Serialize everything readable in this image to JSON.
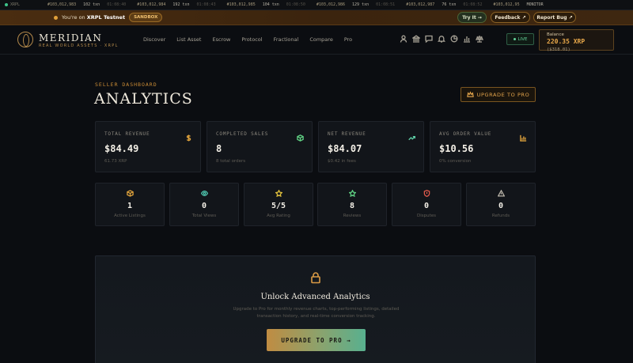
{
  "ticker": {
    "label": "XRPL",
    "items": [
      {
        "block": "#103,012,983",
        "txn": "102 txn",
        "time": "01:08:40"
      },
      {
        "block": "#103,012,984",
        "txn": "192 txn",
        "time": "01:08:43"
      },
      {
        "block": "#103,012,985",
        "txn": "104 txn",
        "time": "01:08:50"
      },
      {
        "block": "#103,012,986",
        "txn": "129 txn",
        "time": "01:08:51"
      },
      {
        "block": "#103,012,987",
        "txn": "76 txn",
        "time": "01:08:52"
      },
      {
        "block": "#103,012,95",
        "txn": "MONITOR",
        "time": ""
      }
    ]
  },
  "banner": {
    "prefix": "You're on",
    "network": "XRPL Testnet",
    "badge": "SANDBOX",
    "try_label": "Try It →",
    "feedback_label": "Feedback ↗",
    "report_label": "Report Bug ↗"
  },
  "header": {
    "brand": "MERIDIAN",
    "tagline": "REAL WORLD ASSETS · XRPL",
    "nav": [
      "Discover",
      "List Asset",
      "Escrow",
      "Protocol",
      "Fractional",
      "Compare",
      "Pro"
    ],
    "icons": [
      "user-icon",
      "bank-icon",
      "chat-icon",
      "bell-icon",
      "pie-chart-icon",
      "bar-chart-icon",
      "scale-icon"
    ],
    "live_label": "LIVE",
    "balance_label": "Balance",
    "balance_value": "220.35 XRP",
    "balance_fiat": "($318.01)"
  },
  "page": {
    "kicker": "SELLER DASHBOARD",
    "title": "ANALYTICS",
    "upgrade_label": "UPGRADE TO PRO"
  },
  "stats": [
    {
      "label": "TOTAL REVENUE",
      "value": "$84.49",
      "sub": "61.73 XRP",
      "icon": "dollar-icon",
      "color": "#e0a33c"
    },
    {
      "label": "COMPLETED SALES",
      "value": "8",
      "sub": "8 total orders",
      "icon": "box-icon",
      "color": "#5fcf82"
    },
    {
      "label": "NET REVENUE",
      "value": "$84.07",
      "sub": "$0.42 in fees",
      "icon": "trend-up-icon",
      "color": "#5fcfa7"
    },
    {
      "label": "AVG ORDER VALUE",
      "value": "$10.56",
      "sub": "0% conversion",
      "icon": "bar-chart-icon",
      "color": "#e0a33c"
    }
  ],
  "minis": [
    {
      "value": "1",
      "label": "Active Listings",
      "icon": "cube-icon",
      "color": "#e0a33c"
    },
    {
      "value": "0",
      "label": "Total Views",
      "icon": "eye-icon",
      "color": "#4fc7b0"
    },
    {
      "value": "5/5",
      "label": "Avg Rating",
      "icon": "star-icon",
      "color": "#e0c03c"
    },
    {
      "value": "8",
      "label": "Reviews",
      "icon": "star-outline-icon",
      "color": "#5fcf82"
    },
    {
      "value": "0",
      "label": "Disputes",
      "icon": "shield-icon",
      "color": "#e05a4c"
    },
    {
      "value": "0",
      "label": "Refunds",
      "icon": "warning-icon",
      "color": "#b9b4a8"
    }
  ],
  "locked": {
    "title": "Unlock Advanced Analytics",
    "desc": "Upgrade to Pro for monthly revenue charts, top-performing listings, detailed transaction history, and real-time conversion tracking.",
    "cta": "UPGRADE TO PRO →"
  }
}
